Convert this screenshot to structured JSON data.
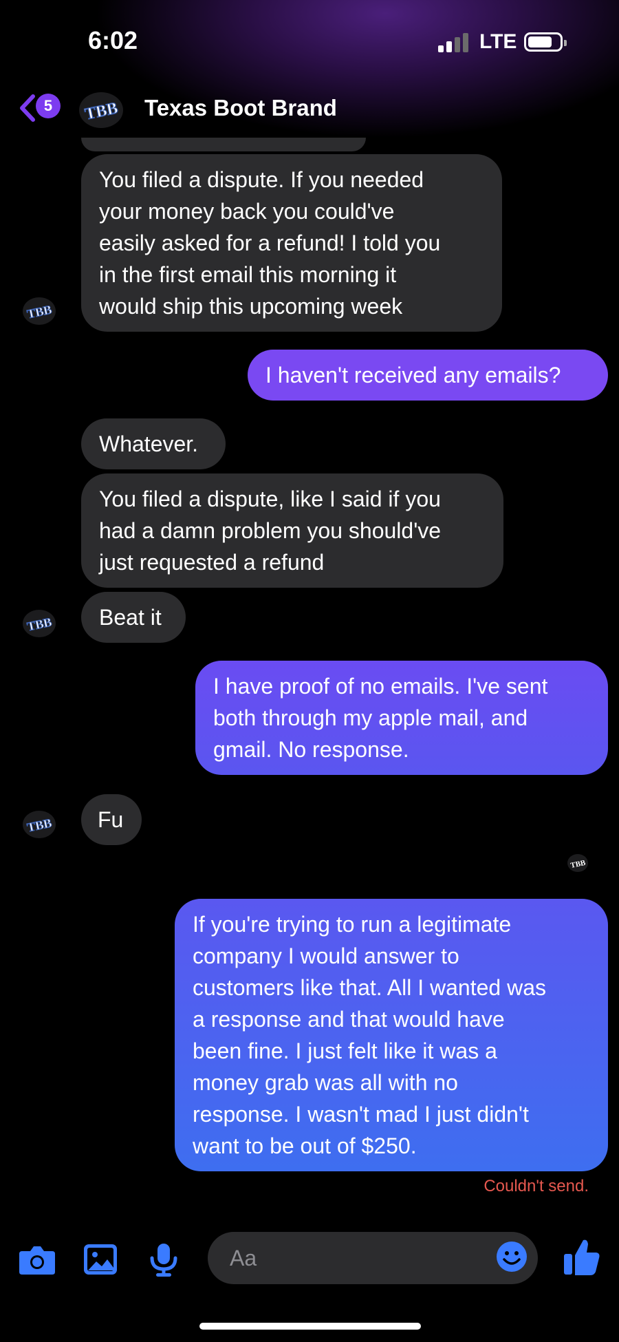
{
  "status_bar": {
    "time": "6:02",
    "network": "LTE",
    "signal_bars": 2,
    "signal_total": 4
  },
  "header": {
    "back_badge": "5",
    "title": "Texas Boot Brand",
    "avatar_monogram": "TBB",
    "accent_color": "#7d3cf0"
  },
  "messages": [
    {
      "from": "them",
      "lines": [
        "You filed a dispute. If you needed",
        "your money back you could've",
        "easily asked for a refund! I told you",
        "in the first email this morning it",
        "would ship this upcoming week"
      ]
    },
    {
      "from": "me",
      "lines": [
        "I haven't received any emails?"
      ]
    },
    {
      "from": "them",
      "lines": [
        "Whatever."
      ]
    },
    {
      "from": "them",
      "lines": [
        "You filed a dispute, like I said if you",
        "had a damn problem you should've",
        "just requested a refund"
      ]
    },
    {
      "from": "them",
      "lines": [
        "Beat it"
      ]
    },
    {
      "from": "me",
      "lines": [
        "I have proof of no emails. I've sent",
        "both through my apple mail, and",
        "gmail. No response."
      ]
    },
    {
      "from": "them",
      "lines": [
        "Fu"
      ]
    },
    {
      "from": "me",
      "lines": [
        "If you're trying to run a legitimate",
        "company I would answer to",
        "customers like that. All I wanted was",
        "a response and that would have",
        "been fine. I just felt like it was a",
        "money grab was all with no",
        "response. I wasn't mad I just didn't",
        "want to be out of $250."
      ]
    }
  ],
  "send_error": "Couldn't send.",
  "composer": {
    "placeholder": "Aa",
    "icons": [
      "camera-icon",
      "photo-icon",
      "microphone-icon",
      "emoji-icon",
      "thumbs-up-icon"
    ],
    "icon_color": "#3a7bff"
  },
  "colors": {
    "incoming_bubble": "#2c2c2e",
    "outgoing_purple": "#6b4cf2",
    "outgoing_blue": "#3f67f0",
    "error": "#e5584f"
  }
}
